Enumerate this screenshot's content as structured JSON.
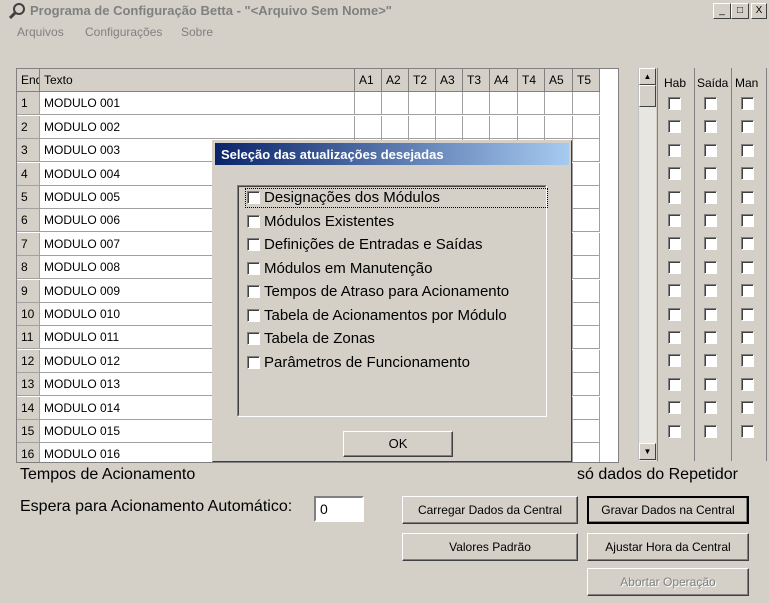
{
  "window": {
    "title": "Programa de Configuração Betta - \"<Arquivo Sem Nome>\"",
    "min": "_",
    "max": "□",
    "close": "X"
  },
  "menu": [
    "Arquivos",
    "Configurações",
    "Sobre"
  ],
  "grid": {
    "headers": [
      "End",
      "Texto",
      "A1",
      "A2",
      "T2",
      "A3",
      "T3",
      "A4",
      "T4",
      "A5",
      "T5"
    ],
    "rows": [
      [
        "1",
        "MODULO 001"
      ],
      [
        "2",
        "MODULO 002"
      ],
      [
        "3",
        "MODULO 003"
      ],
      [
        "4",
        "MODULO 004"
      ],
      [
        "5",
        "MODULO 005"
      ],
      [
        "6",
        "MODULO 006"
      ],
      [
        "7",
        "MODULO 007"
      ],
      [
        "8",
        "MODULO 008"
      ],
      [
        "9",
        "MODULO 009"
      ],
      [
        "10",
        "MODULO 010"
      ],
      [
        "11",
        "MODULO 011"
      ],
      [
        "12",
        "MODULO 012"
      ],
      [
        "13",
        "MODULO 013"
      ],
      [
        "14",
        "MODULO 014"
      ],
      [
        "15",
        "MODULO 015"
      ],
      [
        "16",
        "MODULO 016"
      ]
    ]
  },
  "checkcols": {
    "headers": [
      "Hab",
      "Saída",
      "Man"
    ],
    "rows": 15
  },
  "dialog": {
    "title": "Seleção das atualizações desejadas",
    "options": [
      "Designações dos Módulos",
      "Módulos Existentes",
      "Definições de Entradas e Saídas",
      "Módulos em Manutenção",
      "Tempos de Atraso para Acionamento",
      "Tabela de Acionamentos por Módulo",
      "Tabela de Zonas",
      "Parâmetros de Funcionamento"
    ],
    "ok": "OK"
  },
  "bottom": {
    "tempos_label": "Tempos de Acionamento",
    "repetidor_label": "só dados do Repetidor",
    "espera_label": "Espera para Acionamento Automático:",
    "espera_value": "0",
    "btn_carregar": "Carregar Dados da Central",
    "btn_gravar": "Gravar Dados na Central",
    "btn_valores": "Valores Padrão",
    "btn_ajustar": "Ajustar Hora da Central",
    "btn_abortar": "Abortar Operação"
  }
}
